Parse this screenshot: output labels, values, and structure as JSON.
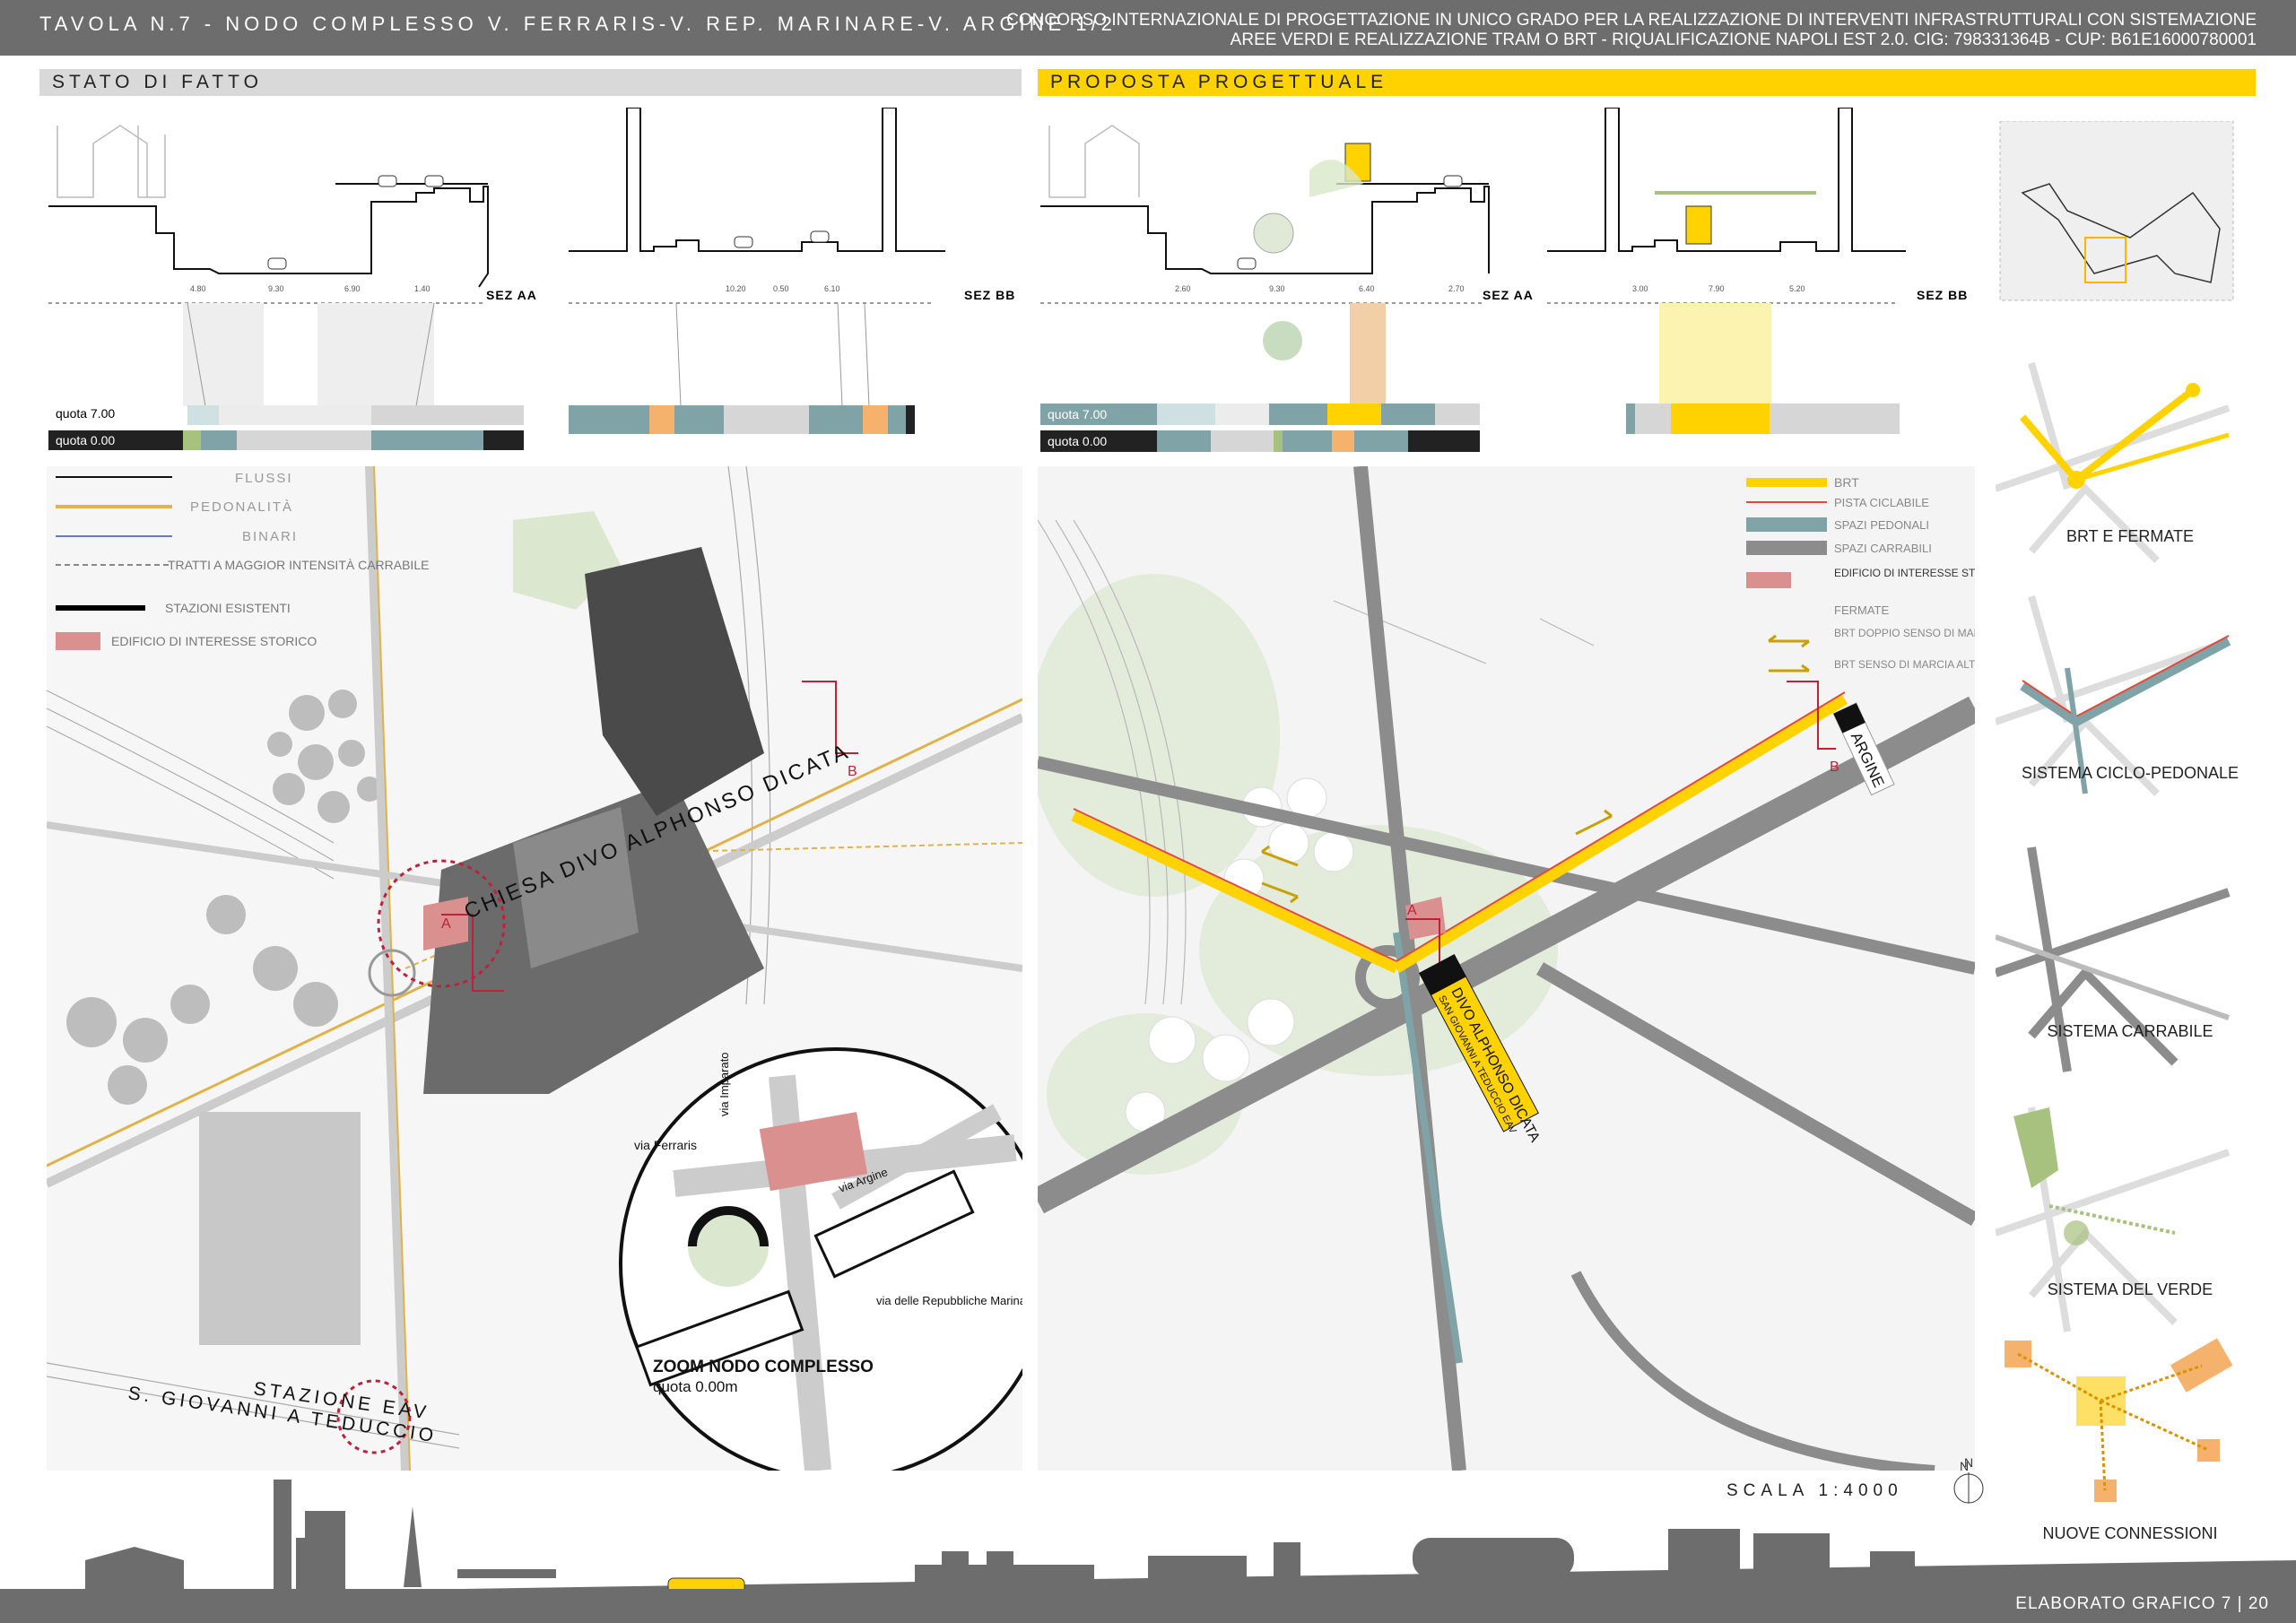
{
  "header": {
    "title_left": "TAVOLA N.7 - NODO COMPLESSO V. FERRARIS-V. REP. MARINARE-V. ARGINE 1/2",
    "title_right_line1": "CONCORSO INTERNAZIONALE DI PROGETTAZIONE IN UNICO GRADO PER LA REALIZZAZIONE DI INTERVENTI INFRASTRUTTURALI CON SISTEMAZIONE",
    "title_right_line2": "AREE VERDI E REALIZZAZIONE TRAM O BRT - RIQUALIFICAZIONE NAPOLI EST 2.0. CIG: 798331364B - CUP: B61E16000780001"
  },
  "sections": {
    "left_title": "STATO DI FATTO",
    "right_title": "PROPOSTA PROGETTUALE"
  },
  "section_labels": {
    "sez_aa": "SEZ AA",
    "sez_bb": "SEZ BB",
    "quota_7": "quota 7.00",
    "quota_0": "quota 0.00"
  },
  "dimensions": {
    "left_aa": [
      "4.80",
      "9.30",
      "6.90",
      "1.40"
    ],
    "left_bb": [
      "10.20",
      "0.50",
      "6.10"
    ],
    "right_aa": [
      "2.60",
      "9.30",
      "6.40",
      "2.70"
    ],
    "right_bb": [
      "3.00",
      "7.90",
      "5.20"
    ]
  },
  "left_legend": {
    "flussi": "FLUSSI",
    "pedonalita": "PEDONALITÀ",
    "binari": "BINARI",
    "tratti": "TRATTI A MAGGIOR INTENSITÀ CARRABILE",
    "stazioni": "STAZIONI ESISTENTI",
    "edificio": "EDIFICIO DI INTERESSE STORICO"
  },
  "right_legend": {
    "brt": "BRT",
    "pista": "PISTA CICLABILE",
    "pedonali": "SPAZI PEDONALI",
    "carrabili": "SPAZI CARRABILI",
    "edificio": "EDIFICIO DI INTERESSE STORICO",
    "fermate": "FERMATE",
    "doppio": "BRT DOPPIO SENSO DI MARCIA",
    "alternato": "BRT SENSO DI MARCIA ALTERNATO"
  },
  "map_labels": {
    "chiesa": "CHIESA DIVO ALPHONSO DICATA",
    "stazione_line1": "STAZIONE EAV",
    "stazione_line2": "S. GIOVANNI A TEDUCCIO",
    "zoom_title": "ZOOM NODO COMPLESSO",
    "zoom_quota": "quota 0.00m",
    "via_ferraris": "via Ferraris",
    "via_imparato": "via Imparato",
    "via_argine": "via Argine",
    "via_repubbliche": "via delle Repubbliche Marinare",
    "marker_a": "A",
    "marker_b": "B",
    "stop_argine": "ARGINE",
    "stop_divo": "DIVO ALPHONSO DICATA",
    "stop_sangiovanni": "SAN GIOVANNI A TEDUCCIO EAV",
    "north": "N",
    "scala": "SCALA 1:4000"
  },
  "sidebar": {
    "items": [
      {
        "label": "BRT E FERMATE"
      },
      {
        "label": "SISTEMA CICLO-PEDONALE"
      },
      {
        "label": "SISTEMA CARRABILE"
      },
      {
        "label": "SISTEMA DEL VERDE"
      },
      {
        "label": "NUOVE CONNESSIONI"
      }
    ]
  },
  "footer": {
    "text": "ELABORATO GRAFICO 7 | 20"
  },
  "colors": {
    "header_gray": "#6d6d6d",
    "brt_yellow": "#ffd200",
    "pedestrian_teal": "#7fa3a6",
    "road_gray": "#8c8c8c",
    "historic_red": "#d9908f",
    "green": "#a7c17f",
    "orange": "#f4b26c"
  }
}
